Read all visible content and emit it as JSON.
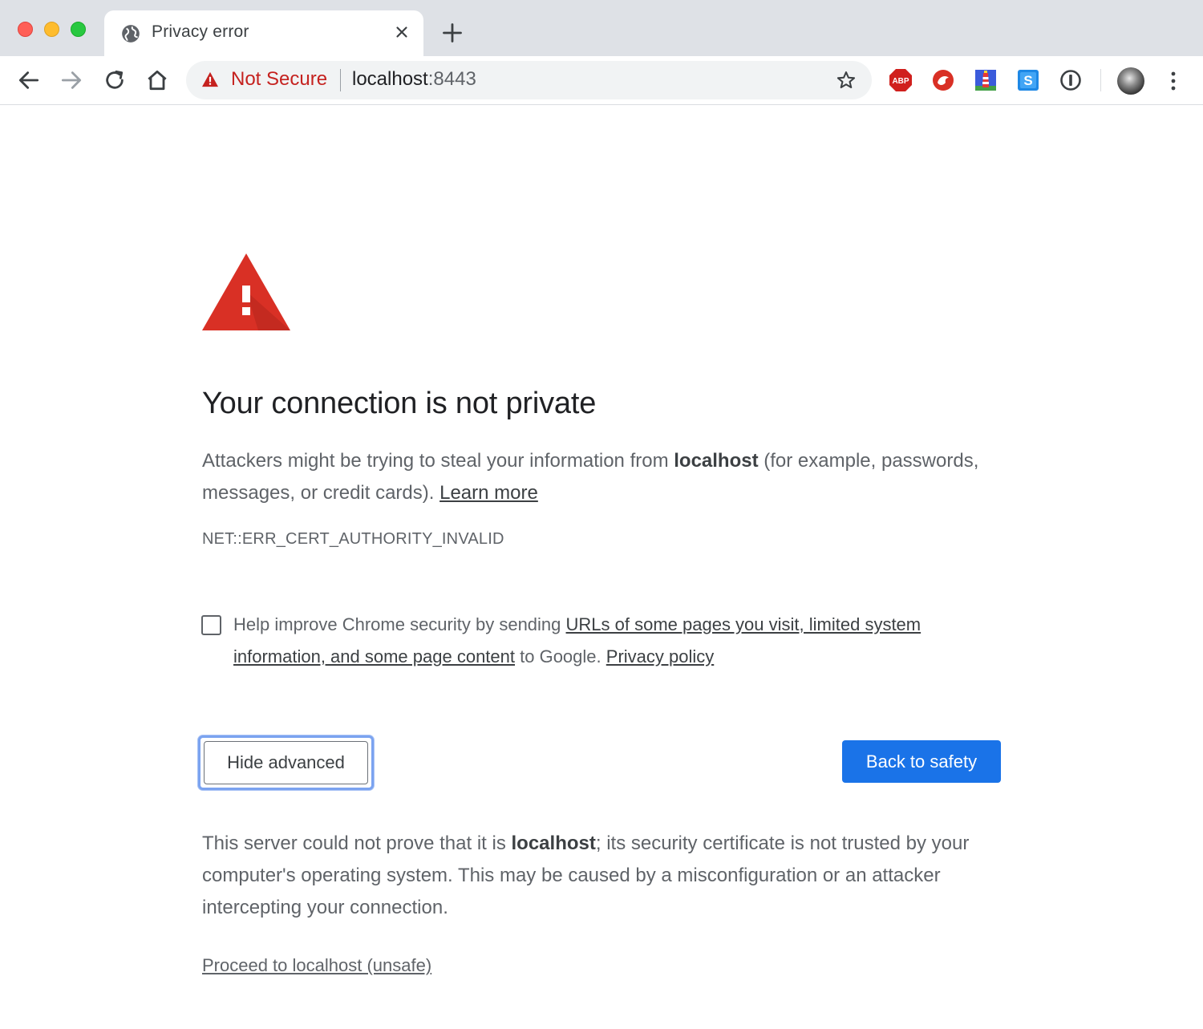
{
  "window": {
    "tab_title": "Privacy error",
    "tab_icon": "globe-icon"
  },
  "toolbar": {
    "security_label": "Not Secure",
    "url_host": "localhost",
    "url_port": ":8443",
    "extensions": [
      "adblock-plus-icon",
      "red-bird-extension-icon",
      "lighthouse-extension-icon",
      "s-extension-icon",
      "1password-icon"
    ],
    "abp_label": "ABP",
    "s_label": "S"
  },
  "page": {
    "heading": "Your connection is not private",
    "intro_part1": "Attackers might be trying to steal your information from ",
    "intro_host": "localhost",
    "intro_part2": " (for example, passwords, messages, or credit cards). ",
    "learn_more": "Learn more",
    "error_code": "NET::ERR_CERT_AUTHORITY_INVALID",
    "optin_part1": "Help improve Chrome security by sending ",
    "optin_link": "URLs of some pages you visit, limited system information, and some page content",
    "optin_part2": " to Google. ",
    "privacy_policy": "Privacy policy",
    "optin_checked": false,
    "hide_advanced": "Hide advanced",
    "back_to_safety": "Back to safety",
    "details_part1": "This server could not prove that it is ",
    "details_host": "localhost",
    "details_part2": "; its security certificate is not trusted by your computer's operating system. This may be caused by a misconfiguration or an attacker intercepting your connection.",
    "proceed_link": "Proceed to localhost (unsafe)"
  },
  "colors": {
    "warning_red": "#d93025",
    "not_secure_red": "#c5221f",
    "primary_blue": "#1a73e8",
    "focus_ring": "#7ba3f0"
  }
}
